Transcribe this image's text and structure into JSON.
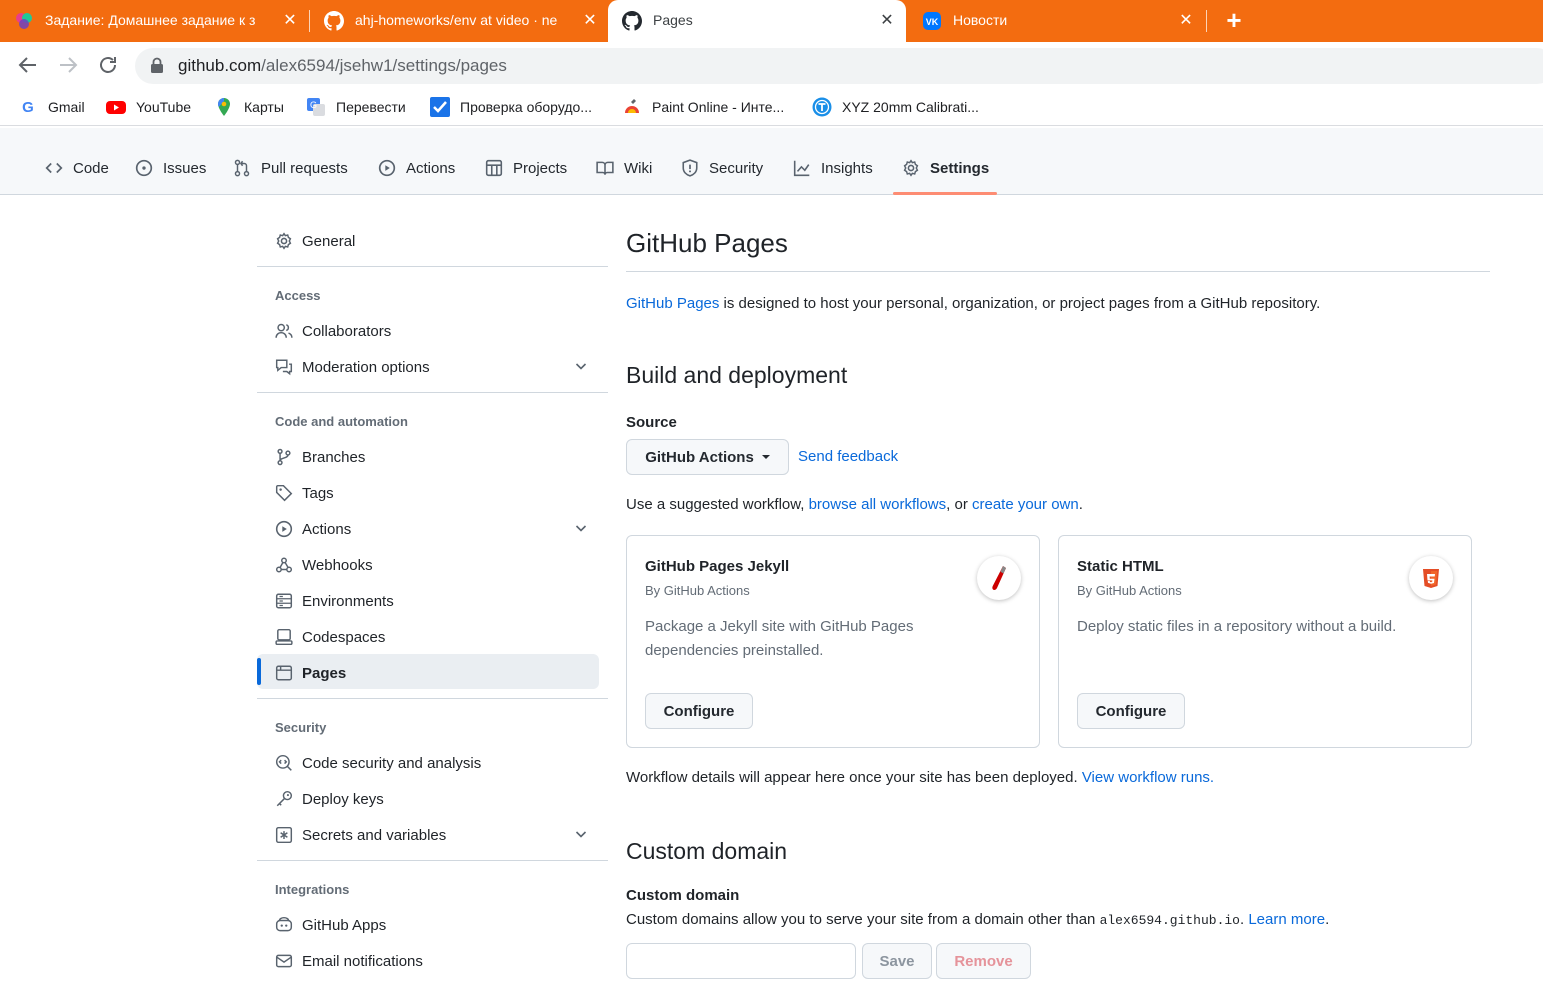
{
  "browser": {
    "tabs": [
      {
        "title": "Задание: Домашнее задание к з",
        "active": false
      },
      {
        "title": "ahj-homeworks/env at video · ne",
        "active": false
      },
      {
        "title": "Pages",
        "active": true
      },
      {
        "title": "Новости",
        "active": false
      }
    ],
    "close_glyph": "✕",
    "newtab_glyph": "+",
    "url_host": "github.com",
    "url_path": "/alex6594/jsehw1/settings/pages",
    "bookmarks": [
      "Gmail",
      "YouTube",
      "Карты",
      "Перевести",
      "Проверка оборудо...",
      "Paint Online - Инте...",
      "XYZ 20mm Calibrati..."
    ]
  },
  "repo_nav": {
    "items": [
      "Code",
      "Issues",
      "Pull requests",
      "Actions",
      "Projects",
      "Wiki",
      "Security",
      "Insights",
      "Settings"
    ],
    "active": "Settings"
  },
  "sidebar": {
    "general": "General",
    "access_heading": "Access",
    "collaborators": "Collaborators",
    "moderation": "Moderation options",
    "code_heading": "Code and automation",
    "branches": "Branches",
    "tags": "Tags",
    "actions": "Actions",
    "webhooks": "Webhooks",
    "environments": "Environments",
    "codespaces": "Codespaces",
    "pages": "Pages",
    "security_heading": "Security",
    "code_security": "Code security and analysis",
    "deploy_keys": "Deploy keys",
    "secrets": "Secrets and variables",
    "integrations_heading": "Integrations",
    "github_apps": "GitHub Apps",
    "email_notifications": "Email notifications"
  },
  "main": {
    "title": "GitHub Pages",
    "intro_link": "GitHub Pages",
    "intro_text": " is designed to host your personal, organization, or project pages from a GitHub repository.",
    "build_heading": "Build and deployment",
    "source_label": "Source",
    "source_value": "GitHub Actions",
    "send_feedback": "Send feedback",
    "suggest_prefix": "Use a suggested workflow, ",
    "suggest_browse": "browse all workflows",
    "suggest_mid": ", or ",
    "suggest_create": "create your own",
    "suggest_end": ".",
    "cards": [
      {
        "title": "GitHub Pages Jekyll",
        "by": "By GitHub Actions",
        "desc": "Package a Jekyll site with GitHub Pages dependencies preinstalled.",
        "button": "Configure"
      },
      {
        "title": "Static HTML",
        "by": "By GitHub Actions",
        "desc": "Deploy static files in a repository without a build.",
        "button": "Configure"
      }
    ],
    "workflow_text": "Workflow details will appear here once your site has been deployed. ",
    "workflow_link": "View workflow runs.",
    "custom_heading": "Custom domain",
    "custom_label": "Custom domain",
    "custom_desc_prefix": "Custom domains allow you to serve your site from a domain other than ",
    "custom_domain_code": "alex6594.github.io",
    "custom_desc_mid": ". ",
    "learn_more": "Learn more",
    "custom_desc_end": ".",
    "custom_input_value": "",
    "save": "Save",
    "remove": "Remove"
  },
  "colors": {
    "tabstrip": "#f36c10",
    "link": "#0969da",
    "underline": "#fd8c73",
    "remove": "#cf222e"
  }
}
